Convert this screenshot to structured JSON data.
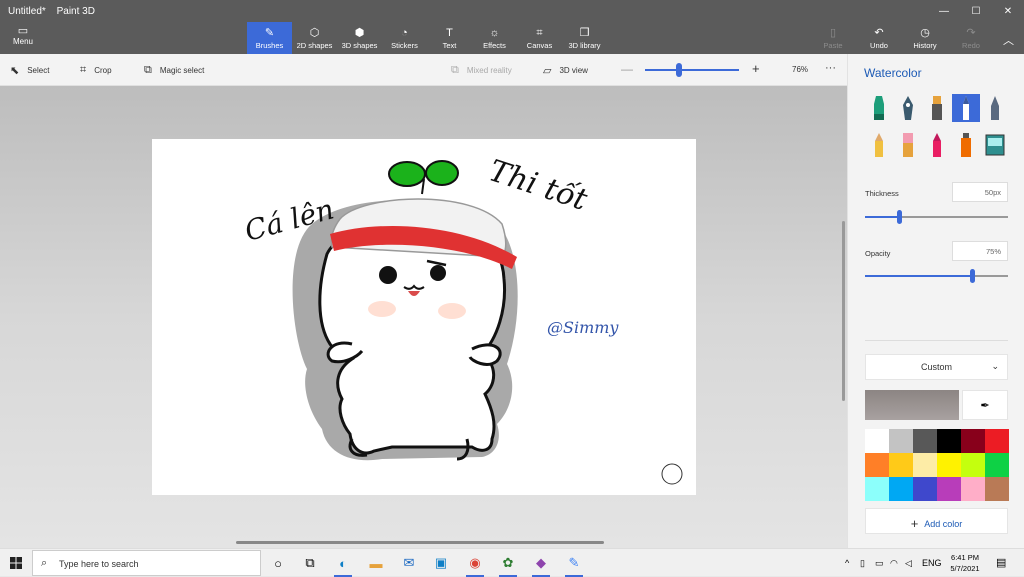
{
  "window": {
    "app_title": "Untitled*",
    "app_name": "Paint 3D",
    "minimize": "—",
    "maximize": "☐",
    "close": "✕"
  },
  "ribbon": {
    "menu": {
      "label": "Menu",
      "icon": "folder-icon"
    },
    "tools": [
      {
        "label": "Brushes",
        "icon": "brush-icon",
        "active": true
      },
      {
        "label": "2D shapes",
        "icon": "2d-shapes-icon"
      },
      {
        "label": "3D shapes",
        "icon": "cube-icon"
      },
      {
        "label": "Stickers",
        "icon": "sticker-icon"
      },
      {
        "label": "Text",
        "icon": "text-icon"
      },
      {
        "label": "Effects",
        "icon": "sun-icon"
      },
      {
        "label": "Canvas",
        "icon": "canvas-icon"
      },
      {
        "label": "3D library",
        "icon": "library-icon"
      }
    ],
    "right_tools": [
      {
        "label": "Paste",
        "disabled": true
      },
      {
        "label": "Undo",
        "disabled": false
      },
      {
        "label": "History",
        "disabled": false
      },
      {
        "label": "Redo",
        "disabled": true
      }
    ]
  },
  "subbar": {
    "select": "Select",
    "crop": "Crop",
    "magic_select": "Magic select",
    "mixed_reality": "Mixed reality",
    "view_3d": "3D view",
    "zoom": "76%",
    "more": "···"
  },
  "canvas": {
    "text_left": "Cá lên",
    "text_right": "Thi tốt",
    "signature": "@Simmy"
  },
  "panel": {
    "title": "Watercolor",
    "brushes": [
      "marker",
      "calligraphy-pen",
      "oil-brush",
      "watercolor",
      "pixel-pen",
      "pencil",
      "eraser",
      "crayon",
      "spray-can",
      "fill"
    ],
    "thickness_label": "Thickness",
    "thickness_value": "50px",
    "thickness_fraction": 0.24,
    "opacity_label": "Opacity",
    "opacity_value": "75%",
    "opacity_fraction": 0.75,
    "color_mode": "Custom",
    "current_color": "#a8a1a0",
    "palette": [
      "#ffffff",
      "#c3c3c3",
      "#585858",
      "#000000",
      "#88001b",
      "#ec1c24",
      "#ff7f27",
      "#ffca18",
      "#fdeca6",
      "#fff200",
      "#c4ff0e",
      "#0ed145",
      "#8cfffb",
      "#00a8f3",
      "#3f48cc",
      "#b83dba",
      "#ffaec8",
      "#b97a56"
    ],
    "add_color": "Add color"
  },
  "taskbar": {
    "search_placeholder": "Type here to search",
    "apps": [
      "task-view-icon",
      "widgets-icon",
      "edge-icon",
      "file-explorer-icon",
      "mail-icon",
      "dell-icon",
      "chrome-icon",
      "app-icon",
      "paint3d-icon",
      "paint-icon"
    ],
    "language": "ENG",
    "time": "6:41 PM",
    "date": "5/7/2021"
  }
}
